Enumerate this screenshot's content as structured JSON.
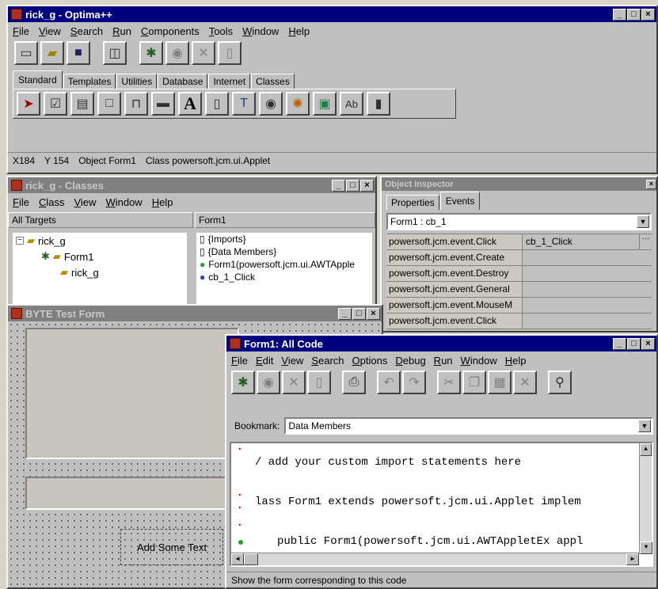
{
  "main": {
    "title": "rick_g - Optima++",
    "menu": [
      "File",
      "View",
      "Search",
      "Run",
      "Components",
      "Tools",
      "Window",
      "Help"
    ],
    "palette_tabs": [
      "Standard",
      "Templates",
      "Utilities",
      "Database",
      "Internet",
      "Classes"
    ],
    "status": {
      "x": "X184",
      "y": "Y 154",
      "object": "Object Form1",
      "class": "Class powersoft.jcm.ui.Applet"
    }
  },
  "classes": {
    "title": "rick_g - Classes",
    "menu": [
      "File",
      "Class",
      "View",
      "Window",
      "Help"
    ],
    "left_header": "All Targets",
    "right_header": "Form1",
    "tree": [
      "rick_g",
      "Form1",
      "rick_g"
    ],
    "members": [
      "{Imports}",
      "{Data Members}",
      "Form1(powersoft.jcm.ui.AWTApple",
      "cb_1_Click"
    ]
  },
  "inspector": {
    "title": "Object Inspector",
    "tabs": [
      "Properties",
      "Events"
    ],
    "selector": "Form1 : cb_1",
    "rows": [
      {
        "k": "powersoft.jcm.event.Click",
        "v": "cb_1_Click"
      },
      {
        "k": "powersoft.jcm.event.Create",
        "v": ""
      },
      {
        "k": "powersoft.jcm.event.Destroy",
        "v": ""
      },
      {
        "k": "powersoft.jcm.event.General",
        "v": ""
      },
      {
        "k": "powersoft.jcm.event.MouseM",
        "v": ""
      },
      {
        "k": "powersoft.jcm.event.Click",
        "v": ""
      }
    ]
  },
  "form": {
    "title": "BYTE Test Form",
    "button": "Add Some Text"
  },
  "code": {
    "title": "Form1: All Code",
    "menu": [
      "File",
      "Edit",
      "View",
      "Search",
      "Options",
      "Debug",
      "Run",
      "Window",
      "Help"
    ],
    "bookmark_label": "Bookmark:",
    "bookmark_value": "Data Members",
    "lines": [
      "/ add your custom import statements here",
      "lass Form1 extends powersoft.jcm.ui.Applet implem",
      "public Form1(powersoft.jcm.ui.AWTAppletEx appl"
    ],
    "status": "Show the form corresponding to this code"
  },
  "caption_buttons": [
    "_",
    "□",
    "×"
  ]
}
